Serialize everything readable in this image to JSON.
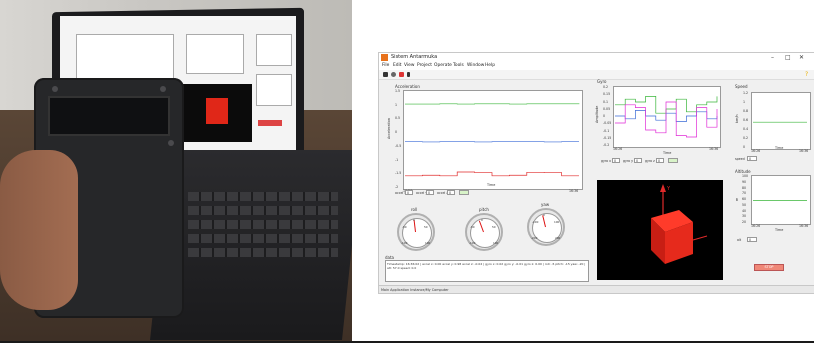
{
  "window": {
    "title": "Sistem Antarmuka",
    "controls": {
      "min": "–",
      "max": "□",
      "close": "✕"
    }
  },
  "menu": [
    "File",
    "Edit",
    "View",
    "Project",
    "Operate",
    "Tools",
    "Window",
    "Help"
  ],
  "panels": {
    "acceleration": {
      "title": "Acceleration",
      "y_axis": "Acceleration",
      "x_axis": "Time",
      "y_ticks": [
        "1.5",
        "1",
        "0.5",
        "0",
        "-0.5",
        "-1",
        "-1.5",
        "-2"
      ],
      "x_start": "16:26",
      "x_end": "16:36",
      "controls": [
        "accel x",
        "accel y",
        "accel z"
      ],
      "controls_values": [
        "0",
        "0",
        "0"
      ]
    },
    "gyro": {
      "title": "Gyro",
      "y_axis": "Amplitude",
      "x_axis": "Time",
      "y_ticks": [
        "0.2",
        "0.15",
        "0.1",
        "0.05",
        "0",
        "-0.05",
        "-0.1",
        "-0.15",
        "-0.2"
      ],
      "x_start": "16:26",
      "x_end": "16:36",
      "controls": [
        "gyro x",
        "gyro y",
        "gyro z"
      ],
      "controls_values": [
        "0",
        "0",
        "0"
      ]
    },
    "speed": {
      "title": "Speed",
      "y_axis": "km/h",
      "x_axis": "Time",
      "y_ticks": [
        "1.2",
        "1",
        "0.8",
        "0.6",
        "0.4",
        "0.2",
        "0"
      ],
      "x_start": "16:26",
      "x_end": "16:36",
      "control_label": "speed",
      "control_value": "0"
    },
    "altitude": {
      "title": "Altitude",
      "y_axis": "m",
      "x_axis": "Time",
      "y_ticks": [
        "100",
        "90",
        "80",
        "70",
        "60",
        "50",
        "40",
        "30",
        "20"
      ],
      "x_start": "16:26",
      "x_end": "16:36",
      "control_label": "alt",
      "control_value": "0"
    },
    "gauges": [
      {
        "label": "roll",
        "value": -5,
        "ticks": [
          "-100",
          "-50",
          "0",
          "50",
          "100"
        ]
      },
      {
        "label": "pitch",
        "value": -15,
        "ticks": [
          "-100",
          "-50",
          "0",
          "50",
          "100"
        ]
      },
      {
        "label": "yaw",
        "value": -20,
        "ticks": [
          "-200",
          "-100",
          "0",
          "100",
          "200"
        ]
      }
    ],
    "data_box": {
      "label": "data",
      "text": "Timestamp: 16:36:02 | accel x: 0.00 accel y: 0.98 accel z: -0.02 | gyro x: 0.02 gyro y: -0.01 gyro z: 0.00 | roll: -5 pitch: -15 yaw: -20 | alt: 57.0 speed: 0.0"
    },
    "viewer3d": {
      "axis_label": "Y"
    },
    "stop_button": "STOP",
    "status": "Main Application Instance/My Computer"
  },
  "chart_data": [
    {
      "type": "line",
      "title": "Acceleration",
      "xlabel": "Time",
      "ylabel": "Acceleration",
      "ylim": [
        -2,
        1.5
      ],
      "x": [
        0,
        10,
        20,
        30,
        40,
        50,
        60,
        70,
        80,
        90,
        100
      ],
      "series": [
        {
          "name": "",
          "color": "#38b538",
          "values": [
            1.05,
            1.05,
            1.06,
            1.05,
            1.06,
            1.06,
            1.05,
            1.06,
            1.06,
            1.06,
            1.07
          ]
        },
        {
          "name": "",
          "color": "#3a6ad6",
          "values": [
            -0.35,
            -0.36,
            -0.35,
            -0.35,
            -0.36,
            -0.35,
            -0.35,
            -0.35,
            -0.36,
            -0.35,
            -0.35
          ]
        },
        {
          "name": "",
          "color": "#e02a2a",
          "values": [
            -1.62,
            -1.6,
            -1.62,
            -1.48,
            -1.5,
            -1.62,
            -1.6,
            -1.49,
            -1.5,
            -1.62,
            -1.62
          ]
        }
      ]
    },
    {
      "type": "line",
      "title": "Gyro",
      "xlabel": "Time",
      "ylabel": "Amplitude",
      "ylim": [
        -0.2,
        0.2
      ],
      "x": [
        0,
        10,
        20,
        30,
        40,
        50,
        60,
        70,
        80,
        90,
        100
      ],
      "series": [
        {
          "name": "",
          "color": "#38b538",
          "values": [
            0.08,
            0.12,
            0.1,
            0.14,
            0.02,
            0.05,
            0.12,
            0.03,
            0.08,
            0.1,
            0.14
          ]
        },
        {
          "name": "",
          "color": "#3a6ad6",
          "values": [
            0.0,
            -0.02,
            0.04,
            0.0,
            -0.03,
            0.02,
            -0.04,
            0.0,
            0.03,
            -0.02,
            0.0
          ]
        },
        {
          "name": "",
          "color": "#e02ad6",
          "values": [
            -0.05,
            0.08,
            0.06,
            -0.1,
            -0.12,
            0.1,
            -0.14,
            -0.15,
            0.06,
            -0.08,
            0.05
          ]
        }
      ]
    },
    {
      "type": "line",
      "title": "Speed",
      "xlabel": "Time",
      "ylabel": "km/h",
      "ylim": [
        0,
        1.2
      ],
      "x": [
        0,
        100
      ],
      "series": [
        {
          "name": "",
          "color": "#38b538",
          "values": [
            0.55,
            0.55
          ]
        }
      ]
    },
    {
      "type": "line",
      "title": "Altitude",
      "xlabel": "Time",
      "ylabel": "m",
      "ylim": [
        20,
        100
      ],
      "x": [
        0,
        100
      ],
      "series": [
        {
          "name": "",
          "color": "#38b538",
          "values": [
            57,
            57
          ]
        }
      ]
    }
  ]
}
